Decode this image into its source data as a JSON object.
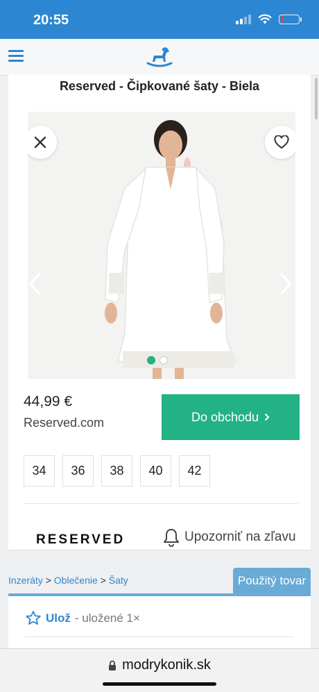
{
  "status_bar": {
    "time": "20:55"
  },
  "product": {
    "title": "Reserved - Čipkované šaty - Biela",
    "price": "44,99 €",
    "shop_domain": "Reserved.com",
    "cta_label": "Do obchodu",
    "sizes": [
      "34",
      "36",
      "38",
      "40",
      "42"
    ],
    "brand_logo": "RESERVED",
    "notify_label": "Upozorniť na zľavu",
    "gallery": {
      "slide_count": 2,
      "active_slide": 1
    }
  },
  "breadcrumb": {
    "items": [
      "Inzeráty",
      "Oblečenie",
      "Šaty"
    ],
    "separator": ">"
  },
  "condition_tab": "Použitý tovar",
  "save": {
    "label": "Ulož",
    "count_text": "- uložené 1×"
  },
  "browser": {
    "url": "modrykonik.sk"
  },
  "colors": {
    "brand_blue": "#2d86d1",
    "accent_green": "#22b286",
    "tab_blue": "#68abd6"
  }
}
